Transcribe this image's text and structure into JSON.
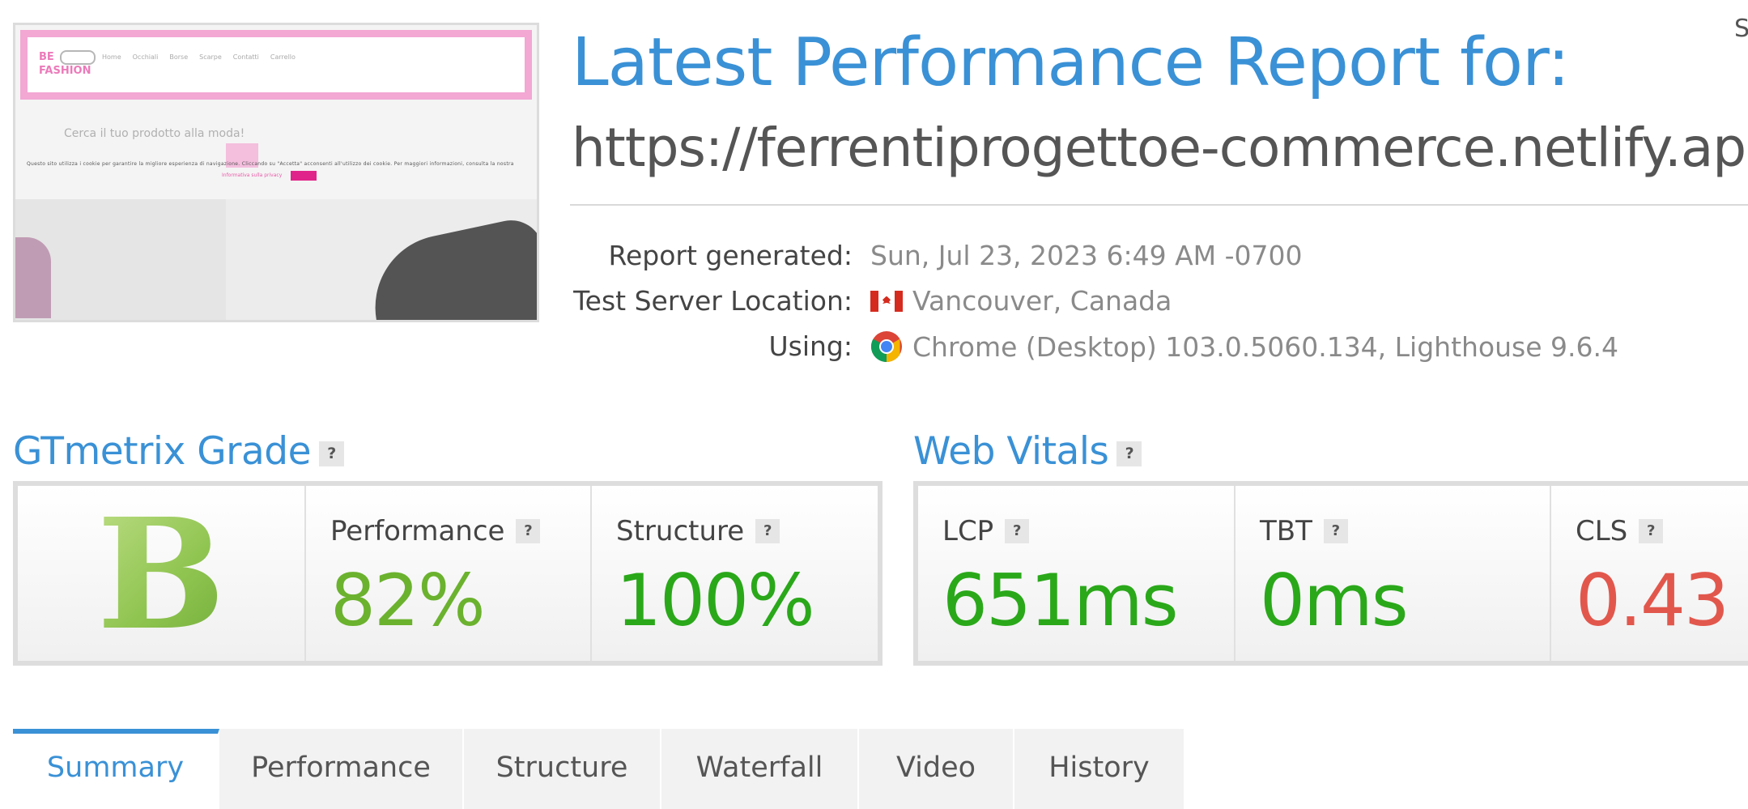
{
  "thumbnail": {
    "logo_line1": "BE",
    "logo_line2": "FASHION",
    "nav": [
      "Home",
      "Occhiali",
      "Borse",
      "Scarpe",
      "Contatti",
      "Carrello"
    ],
    "search_text": "Cerca il tuo prodotto alla moda!",
    "cookie_text": "Questo sito utilizza i cookie per garantire la migliore esperienza di navigazione. Cliccando su \"Accetta\" acconsenti all'utilizzo dei cookie. Per maggiori informazioni, consulta la nostra",
    "cookie_link": "Informativa sulla privacy"
  },
  "header": {
    "title": "Latest Performance Report for:",
    "url": "https://ferrentiprogettoe-commerce.netlify.app/",
    "corner_text": "S"
  },
  "meta": {
    "report_generated_label": "Report generated:",
    "report_generated_value": "Sun, Jul 23, 2023 6:49 AM -0700",
    "server_location_label": "Test Server Location:",
    "server_location_value": "Vancouver, Canada",
    "using_label": "Using:",
    "using_value": "Chrome (Desktop) 103.0.5060.134, Lighthouse 9.6.4"
  },
  "gtmetrix": {
    "title": "GTmetrix Grade",
    "help": "?",
    "grade": "B",
    "performance_label": "Performance",
    "performance_value": "82%",
    "structure_label": "Structure",
    "structure_value": "100%"
  },
  "web_vitals": {
    "title": "Web Vitals",
    "help": "?",
    "lcp_label": "LCP",
    "lcp_value": "651ms",
    "tbt_label": "TBT",
    "tbt_value": "0ms",
    "cls_label": "CLS",
    "cls_value": "0.43"
  },
  "colors": {
    "accent": "#3a91d6",
    "good_green": "#6bb22e",
    "great_green": "#2aa81a",
    "bad_red": "#e2574c"
  },
  "tabs": [
    {
      "label": "Summary"
    },
    {
      "label": "Performance"
    },
    {
      "label": "Structure"
    },
    {
      "label": "Waterfall"
    },
    {
      "label": "Video"
    },
    {
      "label": "History"
    }
  ]
}
